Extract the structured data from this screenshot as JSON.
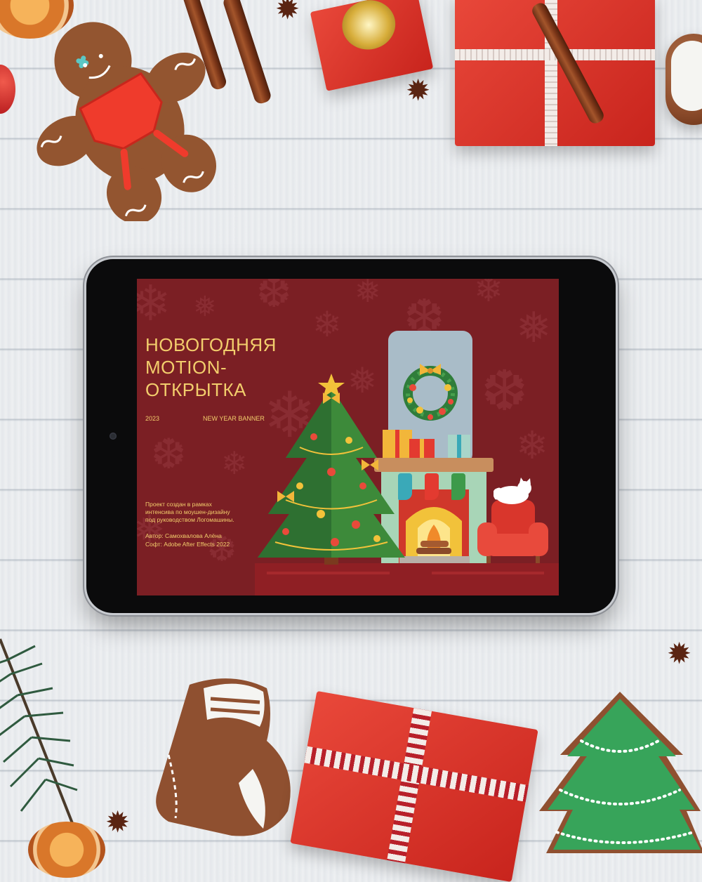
{
  "banner": {
    "title": "НОВОГОДНЯЯ\nMOTION-\nОТКРЫТКА",
    "year": "2023",
    "subtitle": "NEW YEAR BANNER",
    "description": "Проект создан в рамках\nинтенсива по моушен-дизайну\nпод руководством Логомашины.",
    "author": "Автор: Самохвалова Алёна",
    "software": "Софт: Adobe After Effects 2022"
  },
  "colors": {
    "background": "#eef0f2",
    "screen": "#7b1f24",
    "text_accent": "#f2cd6c",
    "tree": "#3d8a3a",
    "armchair": "#d9362c",
    "fireplace": "#a8d5b7",
    "window": "#a9bcc8"
  },
  "icons": [
    "gingerbread-man-icon",
    "gift-box-icon",
    "cinnamon-stick-icon",
    "star-anise-icon",
    "orange-slice-icon",
    "christmas-tree-icon",
    "wreath-icon",
    "fireplace-icon",
    "armchair-icon",
    "cat-icon",
    "stocking-icon",
    "mitten-cookie-icon",
    "tree-cookie-icon",
    "fir-branch-icon"
  ]
}
